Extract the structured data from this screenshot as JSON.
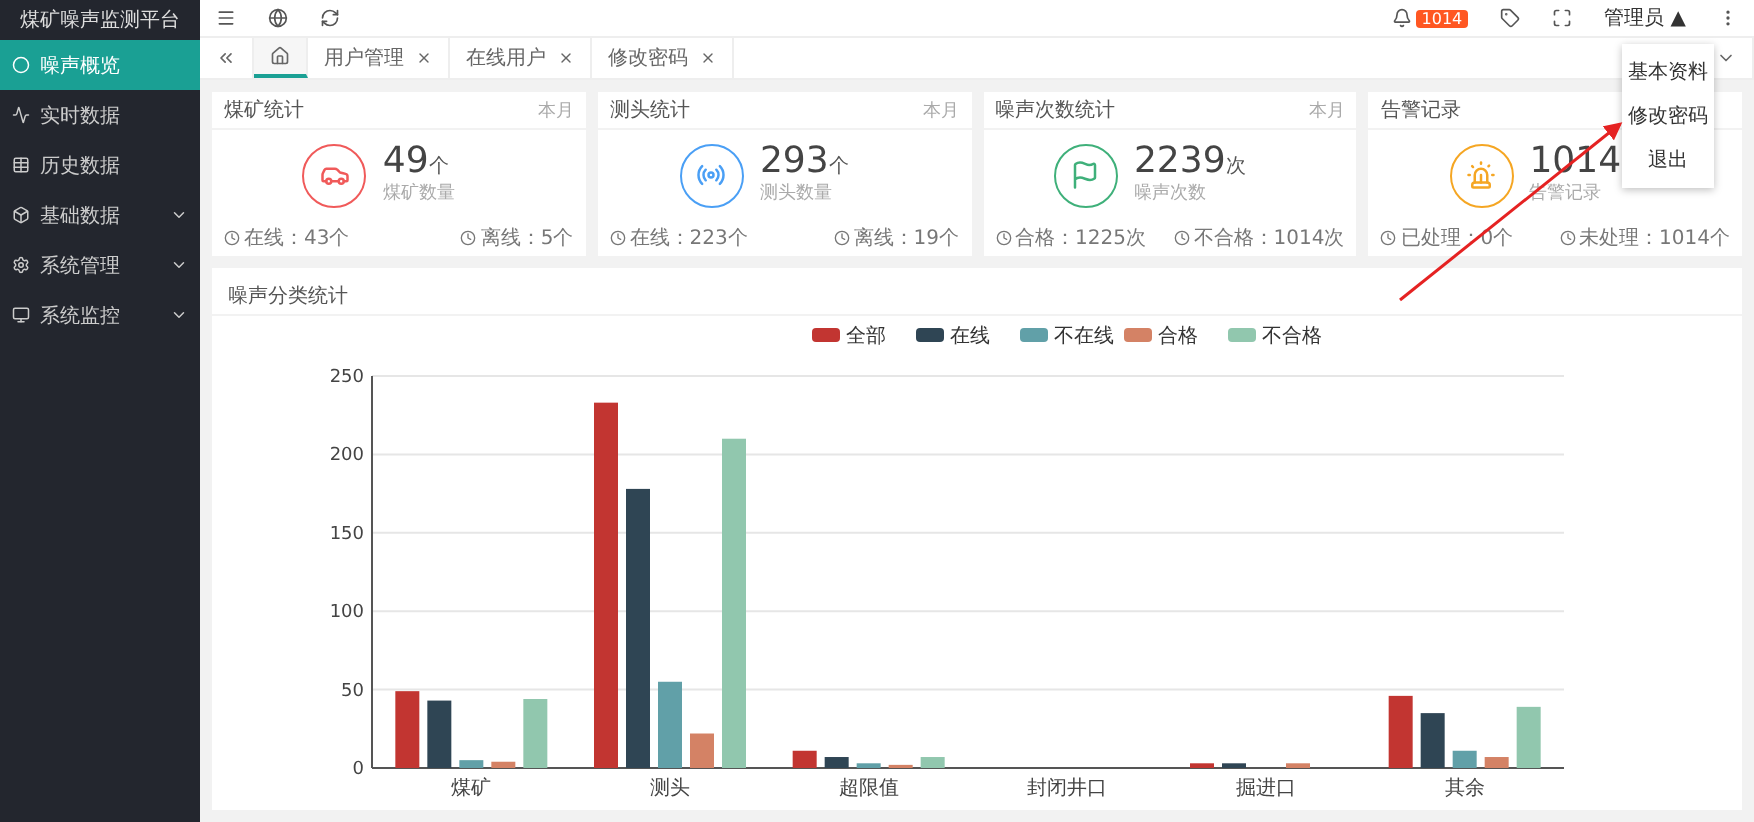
{
  "sidebar": {
    "title": "煤矿噪声监测平台",
    "items": [
      {
        "label": "噪声概览",
        "selected": true,
        "expandable": false
      },
      {
        "label": "实时数据",
        "selected": false,
        "expandable": false
      },
      {
        "label": "历史数据",
        "selected": false,
        "expandable": false
      },
      {
        "label": "基础数据",
        "selected": false,
        "expandable": true
      },
      {
        "label": "系统管理",
        "selected": false,
        "expandable": true
      },
      {
        "label": "系统监控",
        "selected": false,
        "expandable": true
      }
    ]
  },
  "header": {
    "badge": "1014",
    "user": "管理员 ▲"
  },
  "tabs": [
    {
      "kind": "home",
      "selected": true
    },
    {
      "label": "用户管理",
      "kind": "page",
      "selected": false
    },
    {
      "label": "在线用户",
      "kind": "page",
      "selected": false
    },
    {
      "label": "修改密码",
      "kind": "page",
      "selected": false
    }
  ],
  "cards": [
    {
      "title": "煤矿统计",
      "period": "本月",
      "value": "49",
      "unit": "个",
      "caption": "煤矿数量",
      "left": "在线：43个",
      "right": "离线：5个",
      "color": "#f05a5a"
    },
    {
      "title": "测头统计",
      "period": "本月",
      "value": "293",
      "unit": "个",
      "caption": "测头数量",
      "left": "在线：223个",
      "right": "离线：19个",
      "color": "#4a9ff5"
    },
    {
      "title": "噪声次数统计",
      "period": "本月",
      "value": "2239",
      "unit": "次",
      "caption": "噪声次数",
      "left": "合格：1225次",
      "right": "不合格：1014次",
      "color": "#3fb07a"
    },
    {
      "title": "告警记录",
      "value": "1014",
      "caption": "告警记录",
      "left": "已处理：0个",
      "right": "未处理：1014个",
      "color": "#f5a623"
    }
  ],
  "chart_panel": {
    "title": "噪声分类统计",
    "chart_data": {
      "type": "bar",
      "categories": [
        "煤矿",
        "测头",
        "超限值",
        "封闭井口",
        "掘进口",
        "其余"
      ],
      "series": [
        {
          "name": "全部",
          "color": "#c23531",
          "values": [
            49,
            233,
            11,
            0,
            3,
            46
          ]
        },
        {
          "name": "在线",
          "color": "#2f4554",
          "values": [
            43,
            178,
            7,
            0,
            3,
            35
          ]
        },
        {
          "name": "不在线",
          "color": "#61a0a8",
          "values": [
            5,
            55,
            3,
            0,
            0,
            11
          ]
        },
        {
          "name": "合格",
          "color": "#d48265",
          "values": [
            4,
            22,
            2,
            0,
            3,
            7
          ]
        },
        {
          "name": "不合格",
          "color": "#91c7ae",
          "values": [
            44,
            210,
            7,
            0,
            0,
            39
          ]
        }
      ],
      "ylim": [
        0,
        250
      ],
      "yticks": [
        0,
        50,
        100,
        150,
        200,
        250
      ],
      "grid": true,
      "legend": true
    }
  },
  "user_menu": {
    "items": [
      "基本资料",
      "修改密码",
      "退出"
    ]
  }
}
